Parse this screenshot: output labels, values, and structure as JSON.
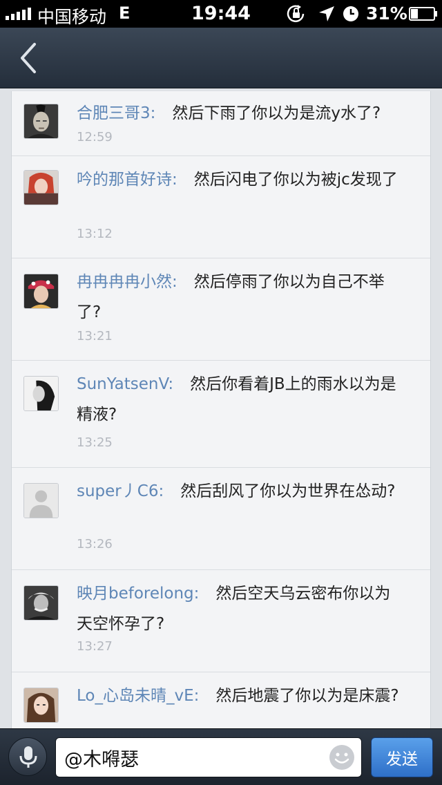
{
  "status_bar": {
    "carrier": "中国移动",
    "network": "E",
    "time": "19:44",
    "battery_percent": "31%",
    "battery_level": 0.31
  },
  "comments": [
    {
      "user": "合肥三哥3:",
      "text": "然后下雨了你以为是流y水了?",
      "time": "12:59"
    },
    {
      "user": "吟的那首好诗:",
      "text": "然后闪电了你以为被jc发现了",
      "time": "13:12"
    },
    {
      "user": "冉冉冉冉小然:",
      "text": "然后停雨了你以为自己不举了?",
      "time": "13:21"
    },
    {
      "user": "SunYatsenV:",
      "text": "然后你看着JB上的雨水以为是精液?",
      "time": "13:25"
    },
    {
      "user": "super丿C6:",
      "text": "然后刮风了你以为世界在怂动?",
      "time": "13:26"
    },
    {
      "user": "映月beforelong:",
      "text": "然后空天乌云密布你以为天空怀孕了?",
      "time": "13:27"
    },
    {
      "user": "Lo_心岛未晴_vE:",
      "text": "然后地震了你以为是床震?",
      "time": ""
    }
  ],
  "input_bar": {
    "input_value": "@木嘚瑟",
    "send_label": "发送"
  },
  "colors": {
    "username": "#5e86b6",
    "send_button": "#3a82dc",
    "nav_bar": "#2f3a48"
  }
}
